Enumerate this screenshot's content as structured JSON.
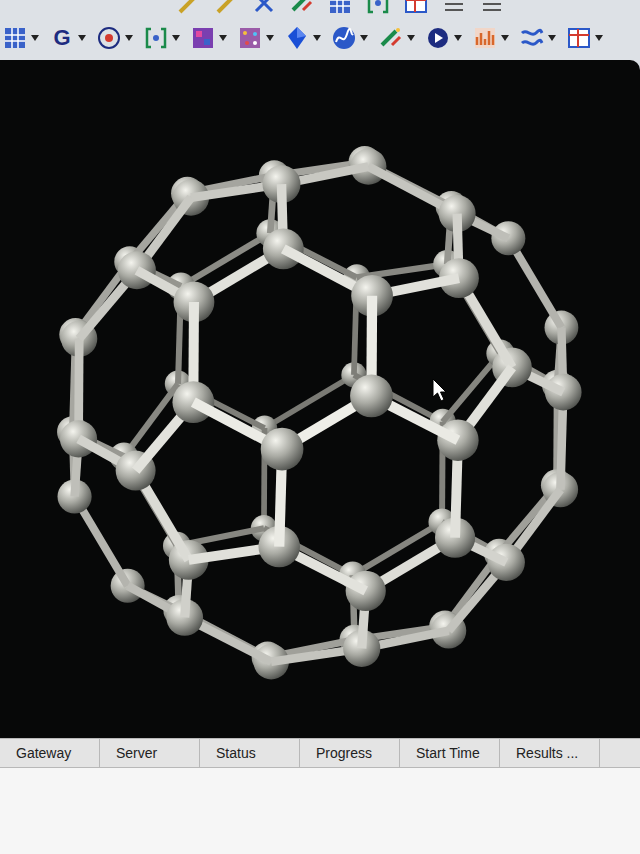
{
  "toolbar": {
    "top_row": [
      {
        "kind": "pen"
      },
      {
        "kind": "pen"
      },
      {
        "kind": "cross"
      },
      {
        "kind": "wand"
      },
      {
        "kind": "grid"
      },
      {
        "kind": "bracket"
      },
      {
        "kind": "table"
      },
      {
        "kind": "list"
      },
      {
        "kind": "list"
      }
    ],
    "main_row": [
      {
        "kind": "grid"
      },
      {
        "kind": "letter",
        "label": "G"
      },
      {
        "kind": "target"
      },
      {
        "kind": "bracket"
      },
      {
        "kind": "palette"
      },
      {
        "kind": "dots"
      },
      {
        "kind": "diamond"
      },
      {
        "kind": "curve"
      },
      {
        "kind": "wand"
      },
      {
        "kind": "play"
      },
      {
        "kind": "chart"
      },
      {
        "kind": "network"
      },
      {
        "kind": "table"
      }
    ]
  },
  "jobs": {
    "columns": [
      "Gateway",
      "Server",
      "Status",
      "Progress",
      "Start Time",
      "Results ..."
    ]
  }
}
